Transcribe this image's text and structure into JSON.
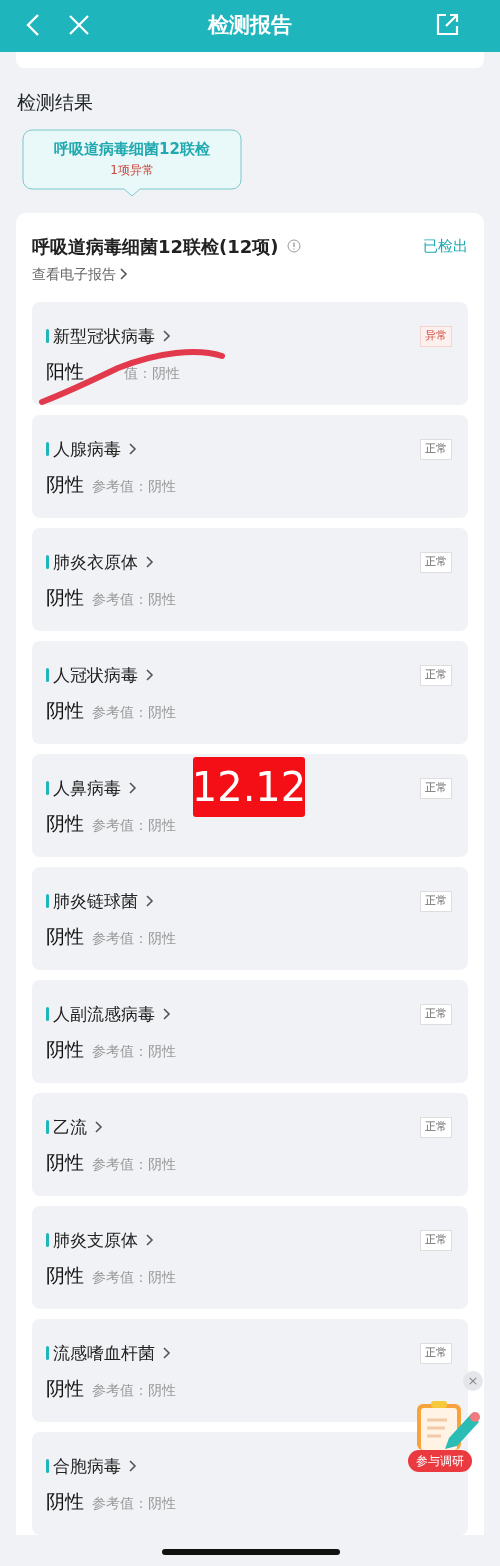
{
  "header": {
    "title": "检测报告"
  },
  "section_title": "检测结果",
  "test_tab": {
    "name": "呼吸道病毒细菌12联检",
    "summary": "1项异常",
    "selected": true
  },
  "panel": {
    "title": "呼吸道病毒细菌12联检(12项)",
    "status": "已检出",
    "report_link": "查看电子报告"
  },
  "items": [
    {
      "name": "新型冠状病毒",
      "result": "阳性",
      "reference": "值：阴性",
      "flag": "异常",
      "abnormal": true,
      "scribbled": true
    },
    {
      "name": "人腺病毒",
      "result": "阴性",
      "reference": "参考值：阴性",
      "flag": "正常",
      "abnormal": false
    },
    {
      "name": "肺炎衣原体",
      "result": "阴性",
      "reference": "参考值：阴性",
      "flag": "正常",
      "abnormal": false
    },
    {
      "name": "人冠状病毒",
      "result": "阴性",
      "reference": "参考值：阴性",
      "flag": "正常",
      "abnormal": false
    },
    {
      "name": "人鼻病毒",
      "result": "阴性",
      "reference": "参考值：阴性",
      "flag": "正常",
      "abnormal": false
    },
    {
      "name": "肺炎链球菌",
      "result": "阴性",
      "reference": "参考值：阴性",
      "flag": "正常",
      "abnormal": false
    },
    {
      "name": "人副流感病毒",
      "result": "阴性",
      "reference": "参考值：阴性",
      "flag": "正常",
      "abnormal": false
    },
    {
      "name": "乙流",
      "result": "阴性",
      "reference": "参考值：阴性",
      "flag": "正常",
      "abnormal": false
    },
    {
      "name": "肺炎支原体",
      "result": "阴性",
      "reference": "参考值：阴性",
      "flag": "正常",
      "abnormal": false
    },
    {
      "name": "流感嗜血杆菌",
      "result": "阴性",
      "reference": "参考值：阴性",
      "flag": "正常",
      "abnormal": false
    },
    {
      "name": "合胞病毒",
      "result": "阴性",
      "reference": "参考值：阴性"
    }
  ],
  "sticker": "12.12",
  "survey": {
    "label": "参与调研",
    "close": "×"
  }
}
